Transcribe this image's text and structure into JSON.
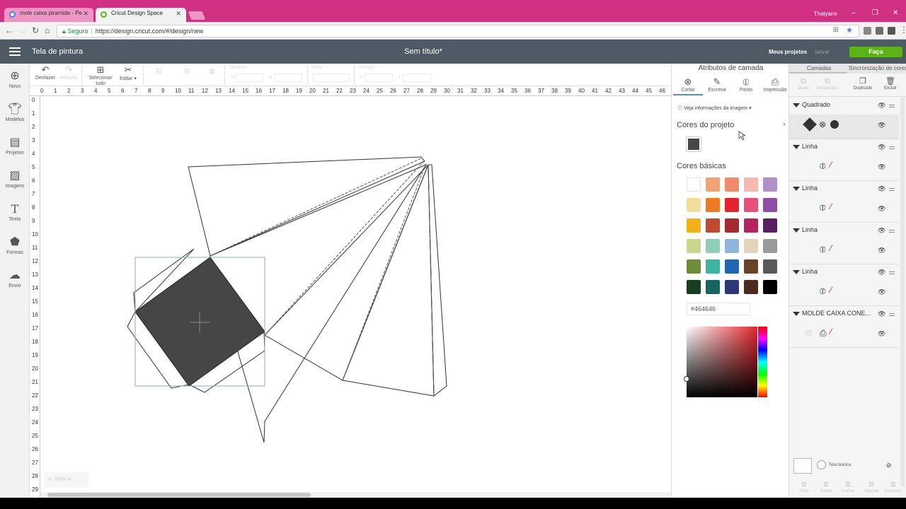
{
  "browser": {
    "tabs": [
      {
        "title": "mole caixa piramide - Pe",
        "icon": "google-icon",
        "active": false
      },
      {
        "title": "Cricut Design Space",
        "icon": "cricut-icon",
        "active": true
      }
    ],
    "profile": "Thatyane",
    "address": {
      "secure_label": "Seguro",
      "url": "https://design.cricut.com/#/design/new"
    },
    "colors": {
      "tabbar": "#d12f82"
    }
  },
  "app": {
    "menu_icon": "hamburger-icon",
    "title": "Tela de pintura",
    "document_title": "Sem título*",
    "my_projects": "Meus projetos",
    "save": "salvar",
    "make": "Faça",
    "colors": {
      "header": "#4d5a64",
      "make": "#5bb316"
    }
  },
  "sidebar": {
    "items": [
      {
        "label": "Novo",
        "icon": "plus-circle-icon"
      },
      {
        "label": "Modelos",
        "icon": "shirt-icon"
      },
      {
        "label": "Projetos",
        "icon": "projects-icon"
      },
      {
        "label": "Imagens",
        "icon": "image-icon"
      },
      {
        "label": "Texto",
        "icon": "text-icon"
      },
      {
        "label": "Formas",
        "icon": "shapes-icon"
      },
      {
        "label": "Envio",
        "icon": "upload-icon"
      }
    ]
  },
  "toolbar": {
    "undo": "Desfazer",
    "redo": "Refazer",
    "select_all": "Selecionar tudo",
    "edit": "Editar",
    "size": "Tamanho",
    "w": "W",
    "h": "H",
    "rotate": "Girar",
    "position": "Posição",
    "x": "X",
    "y": "Y"
  },
  "rulers": {
    "top": [
      "0",
      "1",
      "2",
      "3",
      "4",
      "5",
      "6",
      "7",
      "8",
      "9",
      "10",
      "11",
      "12",
      "13",
      "14",
      "15",
      "16",
      "17",
      "18",
      "19",
      "20",
      "21",
      "22",
      "23",
      "24",
      "25",
      "26",
      "27",
      "28",
      "29",
      "30",
      "31",
      "32",
      "33",
      "34",
      "35",
      "36",
      "37",
      "38",
      "39",
      "40",
      "41",
      "42",
      "43",
      "44",
      "45",
      "46"
    ],
    "left": [
      "0",
      "1",
      "2",
      "3",
      "4",
      "5",
      "6",
      "7",
      "8",
      "9",
      "10",
      "11",
      "12",
      "13",
      "14",
      "15",
      "16",
      "17",
      "18",
      "19",
      "20",
      "21",
      "22",
      "23",
      "24",
      "25",
      "26",
      "27",
      "28",
      "29"
    ]
  },
  "canvas": {
    "zoom": "100%",
    "fill_color": "#464646"
  },
  "attributes": {
    "title": "Atributos de camada",
    "tabs": [
      {
        "label": "Cortar",
        "icon": "blade-icon",
        "selected": true
      },
      {
        "label": "Escreva",
        "icon": "pen-icon",
        "selected": false
      },
      {
        "label": "Ponto",
        "icon": "score-icon",
        "selected": false
      },
      {
        "label": "Impressão",
        "icon": "printer-icon",
        "selected": false
      }
    ],
    "image_info": "Veja informações da imagem",
    "project_colors_title": "Cores do projeto",
    "project_color": "#464646",
    "basic_colors_title": "Cores básicas",
    "basic_colors": [
      "#ffffff",
      "#f3a273",
      "#f08a6c",
      "#f6b8b1",
      "#b28fca",
      "#f2dd9c",
      "#ec7a1e",
      "#e4242c",
      "#e8507a",
      "#8d4ea6",
      "#f3b119",
      "#bf4832",
      "#a92a2e",
      "#b6235e",
      "#5a1e62",
      "#c9d68c",
      "#8dcdb9",
      "#8fb5de",
      "#e0d5b8",
      "#9a9a9a",
      "#6f8d39",
      "#3bb5a2",
      "#1e67b2",
      "#6b4225",
      "#595959",
      "#183d1f",
      "#156561",
      "#2d3678",
      "#4e2b1f",
      "#000000"
    ],
    "hex_value": "#464646"
  },
  "layers": {
    "tabs": [
      "Camadas",
      "Sincronização de cores"
    ],
    "actions": [
      {
        "label": "Grupo",
        "icon": "group-icon",
        "enabled": false
      },
      {
        "label": "Desagrupar",
        "icon": "ungroup-icon",
        "enabled": false
      },
      {
        "label": "Duplicado",
        "icon": "duplicate-icon",
        "enabled": true
      },
      {
        "label": "Excluir",
        "icon": "trash-icon",
        "enabled": true
      }
    ],
    "groups": [
      {
        "name": "Quadrado",
        "op": "cut",
        "selected": true
      },
      {
        "name": "Linha",
        "op": "score",
        "selected": false
      },
      {
        "name": "Linha",
        "op": "score",
        "selected": false
      },
      {
        "name": "Linha",
        "op": "score",
        "selected": false
      },
      {
        "name": "Linha",
        "op": "score",
        "selected": false
      },
      {
        "name": "MOLDE CAIXA CONE...",
        "op": "print",
        "selected": false
      }
    ],
    "canvas_label": "Tela branca",
    "bottom_actions": [
      "Fatia",
      "Soldar",
      "Anexar",
      "Aplanar",
      "Contorno"
    ]
  }
}
